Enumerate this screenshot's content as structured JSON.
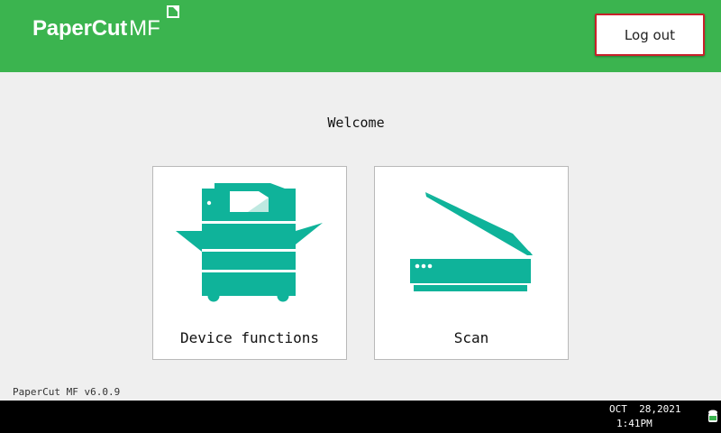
{
  "header": {
    "logo_bold": "PaperCut",
    "logo_light": "MF",
    "logout_label": "Log out"
  },
  "main": {
    "welcome": "Welcome",
    "tiles": [
      {
        "label": "Device functions",
        "icon": "copier-icon"
      },
      {
        "label": "Scan",
        "icon": "scanner-icon"
      }
    ]
  },
  "footer": {
    "version": "PaperCut MF v6.0.9"
  },
  "statusbar": {
    "date": "OCT  28,2021",
    "time": "1:41PM",
    "icon": "status-icon"
  },
  "colors": {
    "brand_green": "#3bb44f",
    "icon_teal": "#0fb39a",
    "logout_border": "#c8202a"
  }
}
